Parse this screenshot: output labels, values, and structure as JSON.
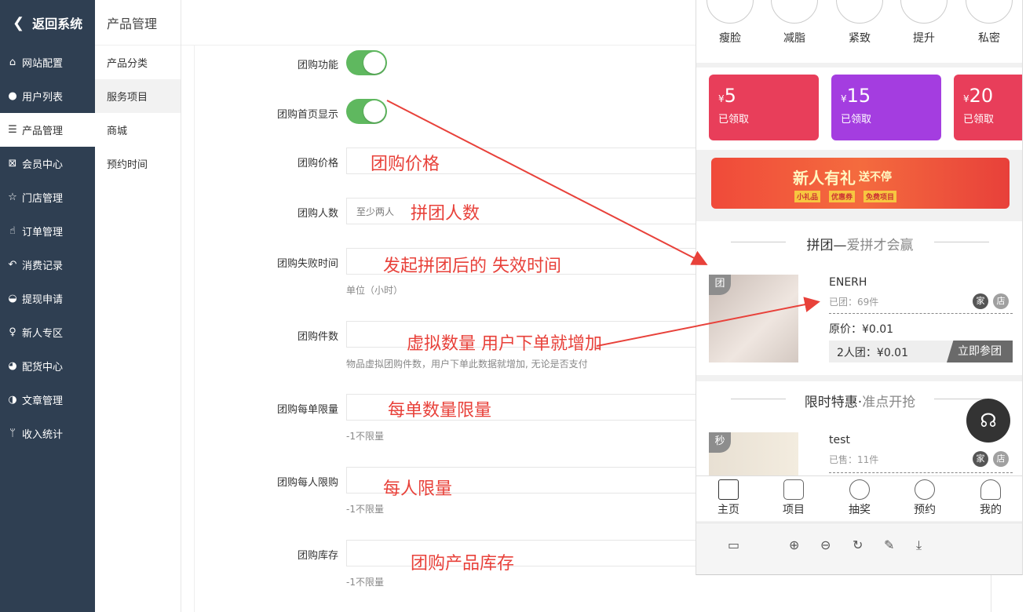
{
  "leftnav": {
    "back_label": "返回系统",
    "items": [
      {
        "icon": "home-icon",
        "glyph": "⌂",
        "label": "网站配置"
      },
      {
        "icon": "user-icon",
        "glyph": "●",
        "label": "用户列表"
      },
      {
        "icon": "server-icon",
        "glyph": "☰",
        "label": "产品管理"
      },
      {
        "icon": "cart-icon",
        "glyph": "⊠",
        "label": "会员中心"
      },
      {
        "icon": "star-icon",
        "glyph": "☆",
        "label": "门店管理"
      },
      {
        "icon": "thumb-icon",
        "glyph": "☝",
        "label": "订单管理"
      },
      {
        "icon": "reply-icon",
        "glyph": "↶",
        "label": "消费记录"
      },
      {
        "icon": "wechat-icon",
        "glyph": "◒",
        "label": "提现申请"
      },
      {
        "icon": "pin-icon",
        "glyph": "♀",
        "label": "新人专区"
      },
      {
        "icon": "pie-icon",
        "glyph": "◕",
        "label": "配货中心"
      },
      {
        "icon": "contrast-icon",
        "glyph": "◑",
        "label": "文章管理"
      },
      {
        "icon": "branch-icon",
        "glyph": "ᛘ",
        "label": "收入统计"
      }
    ]
  },
  "subnav": {
    "title": "产品管理",
    "items": [
      "产品分类",
      "服务项目",
      "商城",
      "预约时间"
    ]
  },
  "form": {
    "groupbuy_enabled": {
      "label": "团购功能"
    },
    "groupbuy_home": {
      "label": "团购首页显示"
    },
    "price": {
      "label": "团购价格"
    },
    "people": {
      "label": "团购人数",
      "placeholder": "至少两人"
    },
    "fail_time": {
      "label": "团购失败时间",
      "hint": "单位（小时）"
    },
    "count": {
      "label": "团购件数",
      "hint": "物品虚拟团购件数，用户下单此数据就增加, 无论是否支付"
    },
    "per_order": {
      "label": "团购每单限量",
      "hint": "-1不限量"
    },
    "per_user": {
      "label": "团购每人限购",
      "hint": "-1不限量"
    },
    "stock": {
      "label": "团购库存",
      "hint": "-1不限量"
    }
  },
  "annotations": {
    "price": "团购价格",
    "people": "拼团人数",
    "fail_time": "发起拼团后的 失效时间",
    "count": "虚拟数量 用户下单就增加",
    "per_order": "每单数量限量",
    "per_user": "每人限量",
    "stock": "团购产品库存"
  },
  "phone": {
    "categories": [
      "瘦脸",
      "减脂",
      "紧致",
      "提升",
      "私密"
    ],
    "coupons": [
      {
        "currency": "¥",
        "amount": "5",
        "status": "已领取",
        "color": "#e83e5a"
      },
      {
        "currency": "¥",
        "amount": "15",
        "status": "已领取",
        "color": "#a43de0"
      },
      {
        "currency": "¥",
        "amount": "20",
        "status": "已领取",
        "color": "#e83e5a"
      }
    ],
    "banner_text": "新人有礼",
    "banner_sub": "送不停",
    "banner_tags": [
      "小礼品",
      "优惠券",
      "免费项目"
    ],
    "groupbuy": {
      "title": "拼团—",
      "subtitle": "爱拼才会赢",
      "tag": "团",
      "name": "ENERH",
      "sold": "已团：69件",
      "badge1": "家",
      "badge2": "店",
      "original": "原价：¥0.01",
      "group_price": "2人团：¥0.01",
      "join": "立即参团"
    },
    "flashsale": {
      "title": "限时特惠·",
      "subtitle": "准点开抢",
      "tag": "秒",
      "name": "test",
      "sold": "已售：11件",
      "badge1": "家",
      "badge2": "店"
    },
    "tabs": [
      "主页",
      "项目",
      "抽奖",
      "预约",
      "我的"
    ],
    "tools": [
      "layout-icon",
      "zoom-in-icon",
      "zoom-out-icon",
      "refresh-icon",
      "edit-icon",
      "download-icon"
    ]
  }
}
